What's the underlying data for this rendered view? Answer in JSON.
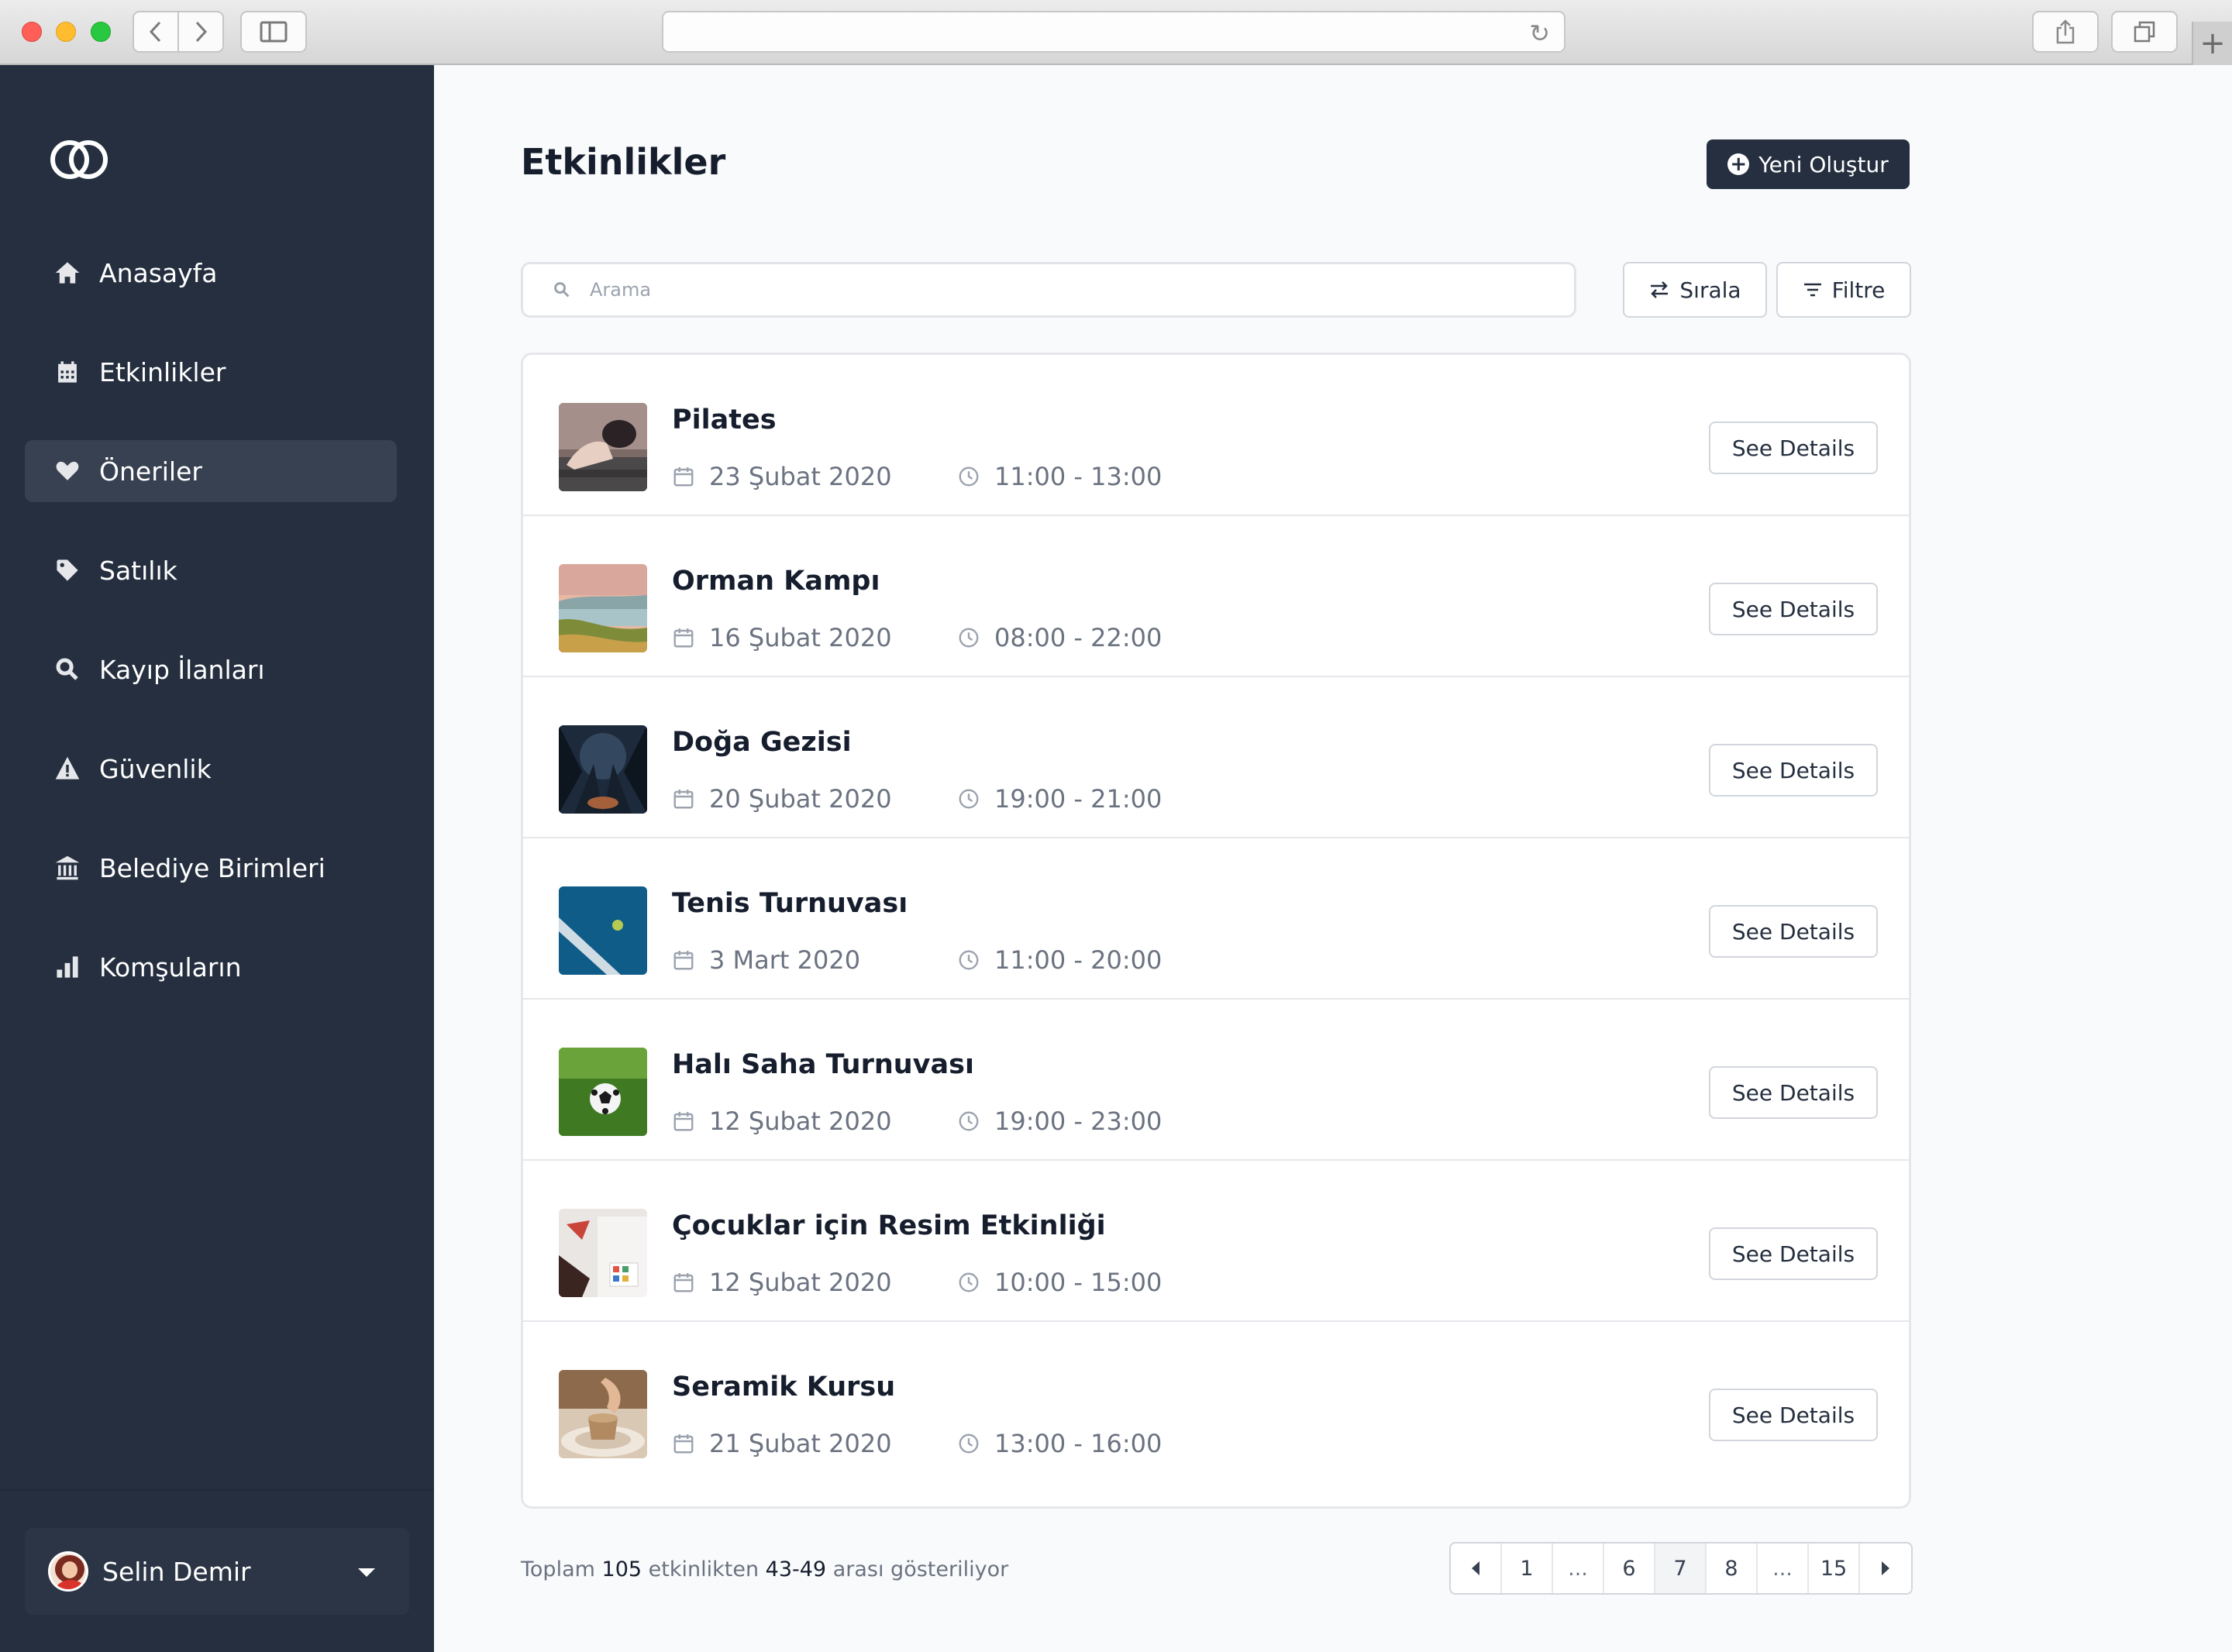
{
  "app": {
    "title": "Etkinlikler",
    "new_button_label": "Yeni Oluştur",
    "accent_color": "#252f3f"
  },
  "sidebar": {
    "items": [
      {
        "label": "Anasayfa",
        "icon": "home-icon",
        "active": false
      },
      {
        "label": "Etkinlikler",
        "icon": "calendar-icon",
        "active": false
      },
      {
        "label": "Öneriler",
        "icon": "heart-icon",
        "active": true
      },
      {
        "label": "Satılık",
        "icon": "tag-icon",
        "active": false
      },
      {
        "label": "Kayıp İlanları",
        "icon": "search-icon",
        "active": false
      },
      {
        "label": "Güvenlik",
        "icon": "warning-icon",
        "active": false
      },
      {
        "label": "Belediye Birimleri",
        "icon": "library-icon",
        "active": false
      },
      {
        "label": "Komşuların",
        "icon": "chart-icon",
        "active": false
      }
    ],
    "user": {
      "name": "Selin Demir"
    }
  },
  "search": {
    "placeholder": "Arama",
    "value": ""
  },
  "toolbar": {
    "sort_label": "Sırala",
    "filter_label": "Filtre"
  },
  "events": [
    {
      "title": "Pilates",
      "date": "23 Şubat 2020",
      "time": "11:00 - 13:00",
      "button": "See Details",
      "thumb": "pilates-photo"
    },
    {
      "title": "Orman Kampı",
      "date": "16 Şubat 2020",
      "time": "08:00 - 22:00",
      "button": "See Details",
      "thumb": "lake-landscape-photo"
    },
    {
      "title": "Doğa Gezisi",
      "date": "20 Şubat 2020",
      "time": "19:00 - 21:00",
      "button": "See Details",
      "thumb": "night-forest-photo"
    },
    {
      "title": "Tenis Turnuvası",
      "date": "3 Mart 2020",
      "time": "11:00 - 20:00",
      "button": "See Details",
      "thumb": "tennis-court-photo"
    },
    {
      "title": "Halı Saha Turnuvası",
      "date": "12 Şubat 2020",
      "time": "19:00 - 23:00",
      "button": "See Details",
      "thumb": "soccer-ball-photo"
    },
    {
      "title": "Çocuklar için Resim Etkinliği",
      "date": "12 Şubat 2020",
      "time": "10:00 - 15:00",
      "button": "See Details",
      "thumb": "painting-photo"
    },
    {
      "title": "Seramik Kursu",
      "date": "21 Şubat 2020",
      "time": "13:00 - 16:00",
      "button": "See Details",
      "thumb": "pottery-photo"
    }
  ],
  "summary": {
    "prefix": "Toplam",
    "total": "105",
    "middle": "etkinlikten",
    "range": "43-49",
    "suffix": "arası gösteriliyor"
  },
  "pagination": {
    "pages": [
      "1",
      "...",
      "6",
      "7",
      "8",
      "...",
      "15"
    ],
    "current": "7"
  }
}
